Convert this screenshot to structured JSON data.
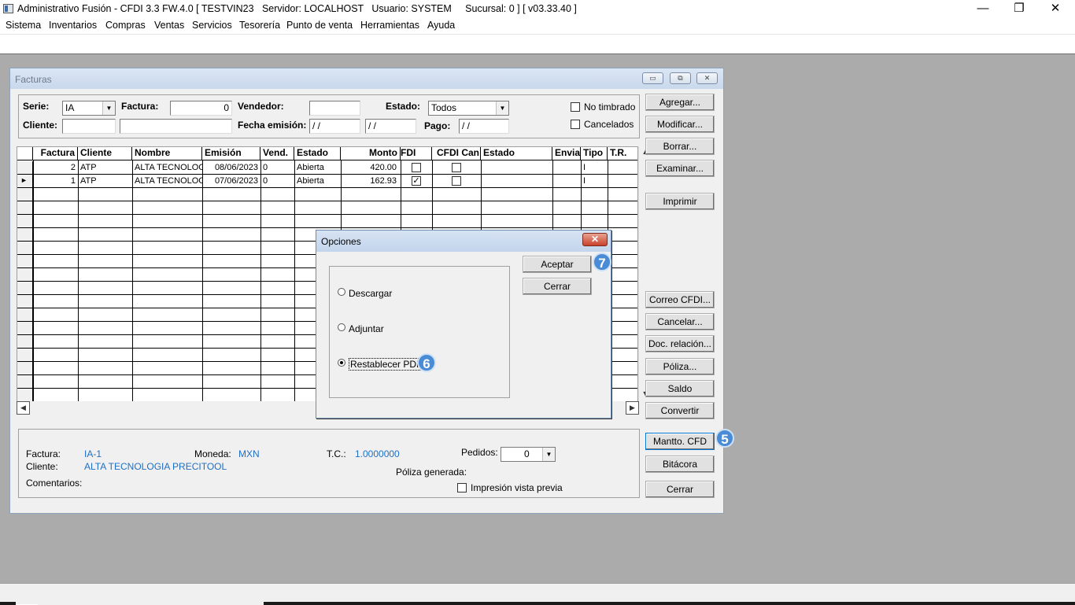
{
  "window": {
    "title": "Administrativo Fusión - CFDI 3.3 FW.4.0 [ TESTVIN23   Servidor: LOCALHOST   Usuario: SYSTEM     Sucursal: 0 ] [ v03.33.40 ]",
    "minimize": "—",
    "maximize": "❐",
    "close": "✕"
  },
  "menu": [
    "Sistema",
    "Inventarios",
    "Compras",
    "Ventas",
    "Servicios",
    "Tesorería",
    "Punto de venta",
    "Herramientas",
    "Ayuda"
  ],
  "facturas_window": {
    "title": "Facturas",
    "filters": {
      "serie_label": "Serie:",
      "serie_value": "IA",
      "factura_label": "Factura:",
      "factura_value": "0",
      "vendedor_label": "Vendedor:",
      "vendedor_value": "",
      "estado_label": "Estado:",
      "estado_value": "Todos",
      "no_timbrado_label": "No timbrado",
      "cancelados_label": "Cancelados",
      "cliente_label": "Cliente:",
      "cliente_value": "",
      "nombre_value": "",
      "fecha_label": "Fecha emisión:",
      "fecha_desde": " / /",
      "fecha_hasta": "  / /",
      "pago_label": "Pago:",
      "pago_value": " / /"
    },
    "grid": {
      "columns": [
        "Factura",
        "Cliente",
        "Nombre",
        "Emisión",
        "Vend.",
        "Estado",
        "Monto",
        "FDI",
        "CFDI Can",
        "Estado",
        "Envia",
        "Tipo",
        "T.R."
      ],
      "rows": [
        {
          "factura": "2",
          "cliente": "ATP",
          "nombre": "ALTA TECNOLOG",
          "emision": "08/06/2023",
          "vend": "0",
          "estado": "Abierta",
          "monto": "420.00",
          "fdi": false,
          "cfdi_can": false,
          "tipo": "I",
          "current": false
        },
        {
          "factura": "1",
          "cliente": "ATP",
          "nombre": "ALTA TECNOLOG",
          "emision": "07/06/2023",
          "vend": "0",
          "estado": "Abierta",
          "monto": "162.93",
          "fdi": true,
          "cfdi_can": false,
          "tipo": "I",
          "current": true
        }
      ],
      "current_row_marker": "►"
    },
    "buttons": {
      "agregar": "Agregar...",
      "modificar": "Modificar...",
      "borrar": "Borrar...",
      "examinar": "Examinar...",
      "imprimir": "Imprimir",
      "correo": "Correo CFDI...",
      "cancelar": "Cancelar...",
      "doc_relacion": "Doc. relación...",
      "poliza": "Póliza...",
      "saldo": "Saldo",
      "convertir": "Convertir",
      "mantto": "Mantto. CFD",
      "bitacora": "Bitácora",
      "cerrar": "Cerrar"
    },
    "details": {
      "factura_label": "Factura:",
      "factura_value": "IA-1",
      "moneda_label": "Moneda:",
      "moneda_value": "MXN",
      "tc_label": "T.C.:",
      "tc_value": "1.0000000",
      "pedidos_label": "Pedidos:",
      "pedidos_value": "0",
      "cliente_label": "Cliente:",
      "cliente_value": "ALTA TECNOLOGIA PRECITOOL",
      "poliza_label": "Póliza generada:",
      "comentarios_label": "Comentarios:",
      "impresion_label": "Impresión vista previa"
    }
  },
  "dialog": {
    "title": "Opciones",
    "close": "✕",
    "options": [
      {
        "label": "Descargar",
        "selected": false
      },
      {
        "label": "Adjuntar",
        "selected": false
      },
      {
        "label": "Restablecer PDF",
        "selected": true
      }
    ],
    "aceptar": "Aceptar",
    "cerrar": "Cerrar"
  },
  "badges": {
    "mantto": "5",
    "restablecer": "6",
    "aceptar": "7"
  },
  "colors": {
    "mdi_background": "#ababab",
    "accent_blue": "#1f6fc4",
    "badge": "#4a8bd6"
  }
}
